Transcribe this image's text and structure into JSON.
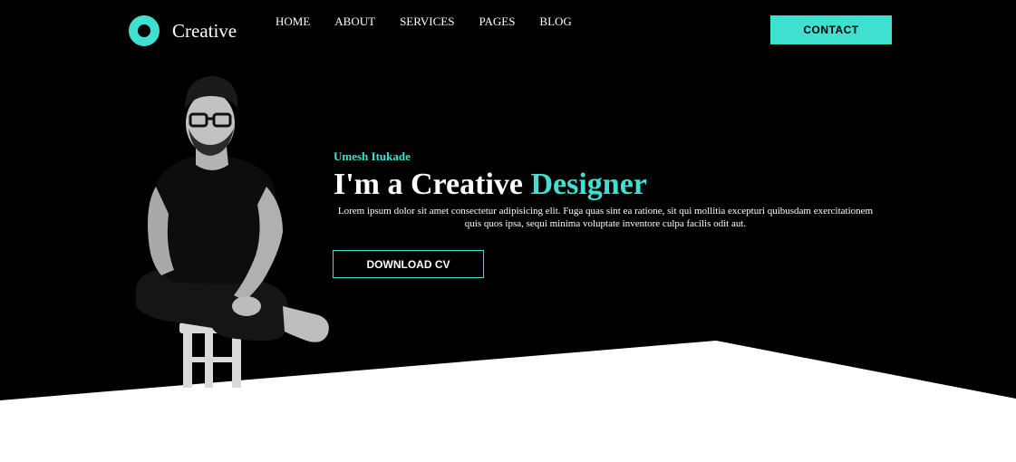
{
  "brand": {
    "name": "Creative",
    "logo_icon": "ring-logo-icon",
    "accent_color": "#3fe0d0"
  },
  "nav": {
    "items": [
      "HOME",
      "ABOUT",
      "SERVICES",
      "PAGES",
      "BLOG"
    ]
  },
  "header": {
    "contact_label": "CONTACT"
  },
  "hero": {
    "name": "Umesh Itukade",
    "title_prefix": "I'm a Creative",
    "title_accent": "Designer",
    "description": "Lorem ipsum dolor sit amet consectetur adipisicing elit. Fuga quas sint ea ratione, sit qui mollitia excepturi quibusdam exercitationem quis quos ipsa, sequi minima voluptate inventore culpa facilis odit aut.",
    "download_label": "DOWNLOAD CV",
    "background_color": "#000000"
  }
}
